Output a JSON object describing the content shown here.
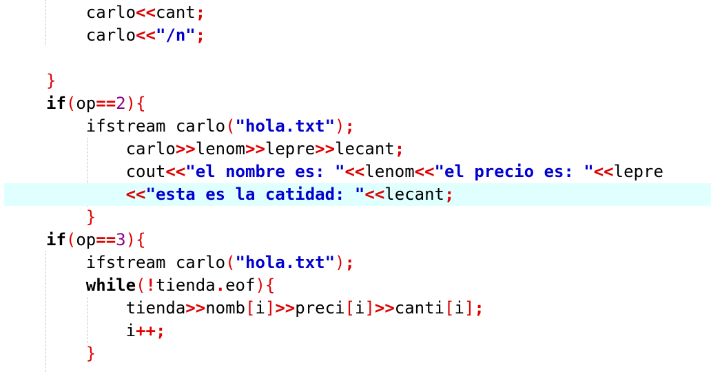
{
  "editor": {
    "current_line_color": "#e0ffff",
    "colors": {
      "operator": "#e00000",
      "number": "#8b008b",
      "string": "#0000d0",
      "keyword": "#000000",
      "plain": "#000000"
    },
    "lines": [
      {
        "tokens": [
          [
            "plain",
            "    carlo"
          ],
          [
            "op",
            "<<"
          ],
          [
            "plain",
            "cant"
          ],
          [
            "op",
            ";"
          ]
        ]
      },
      {
        "tokens": [
          [
            "plain",
            "    carlo"
          ],
          [
            "op",
            "<<"
          ],
          [
            "str",
            "\"/n\""
          ],
          [
            "op",
            ";"
          ]
        ]
      },
      {
        "tokens": []
      },
      {
        "tokens": [
          [
            "brk",
            "}"
          ]
        ]
      },
      {
        "tokens": [
          [
            "kw",
            "if"
          ],
          [
            "brk",
            "("
          ],
          [
            "plain",
            "op"
          ],
          [
            "op",
            "=="
          ],
          [
            "num",
            "2"
          ],
          [
            "brk",
            ")"
          ],
          [
            "brk",
            "{"
          ]
        ]
      },
      {
        "tokens": [
          [
            "plain",
            "    ifstream carlo"
          ],
          [
            "brk",
            "("
          ],
          [
            "str",
            "\"hola.txt\""
          ],
          [
            "brk",
            ")"
          ],
          [
            "op",
            ";"
          ]
        ]
      },
      {
        "tokens": [
          [
            "plain",
            "        carlo"
          ],
          [
            "op",
            ">>"
          ],
          [
            "plain",
            "lenom"
          ],
          [
            "op",
            ">>"
          ],
          [
            "plain",
            "lepre"
          ],
          [
            "op",
            ">>"
          ],
          [
            "plain",
            "lecant"
          ],
          [
            "op",
            ";"
          ]
        ]
      },
      {
        "tokens": [
          [
            "plain",
            "        cout"
          ],
          [
            "op",
            "<<"
          ],
          [
            "str",
            "\"el nombre es: \""
          ],
          [
            "op",
            "<<"
          ],
          [
            "plain",
            "lenom"
          ],
          [
            "op",
            "<<"
          ],
          [
            "str",
            "\"el precio es: \""
          ],
          [
            "op",
            "<<"
          ],
          [
            "plain",
            "lepre"
          ]
        ]
      },
      {
        "tokens": [
          [
            "plain",
            "        "
          ],
          [
            "op",
            "<<"
          ],
          [
            "str",
            "\"esta es la catidad: \""
          ],
          [
            "op",
            "<<"
          ],
          [
            "plain",
            "lecant"
          ],
          [
            "op",
            ";"
          ]
        ],
        "current": true
      },
      {
        "tokens": [
          [
            "plain",
            "    "
          ],
          [
            "brk",
            "}"
          ]
        ]
      },
      {
        "tokens": [
          [
            "kw",
            "if"
          ],
          [
            "brk",
            "("
          ],
          [
            "plain",
            "op"
          ],
          [
            "op",
            "=="
          ],
          [
            "num",
            "3"
          ],
          [
            "brk",
            ")"
          ],
          [
            "brk",
            "{"
          ]
        ]
      },
      {
        "tokens": [
          [
            "plain",
            "    ifstream carlo"
          ],
          [
            "brk",
            "("
          ],
          [
            "str",
            "\"hola.txt\""
          ],
          [
            "brk",
            ")"
          ],
          [
            "op",
            ";"
          ]
        ]
      },
      {
        "tokens": [
          [
            "plain",
            "    "
          ],
          [
            "kw",
            "while"
          ],
          [
            "brk",
            "("
          ],
          [
            "op",
            "!"
          ],
          [
            "plain",
            "tienda"
          ],
          [
            "op",
            "."
          ],
          [
            "plain",
            "eof"
          ],
          [
            "brk",
            ")"
          ],
          [
            "brk",
            "{"
          ]
        ]
      },
      {
        "tokens": [
          [
            "plain",
            "        tienda"
          ],
          [
            "op",
            ">>"
          ],
          [
            "plain",
            "nomb"
          ],
          [
            "brk",
            "["
          ],
          [
            "plain",
            "i"
          ],
          [
            "brk",
            "]"
          ],
          [
            "op",
            ">>"
          ],
          [
            "plain",
            "preci"
          ],
          [
            "brk",
            "["
          ],
          [
            "plain",
            "i"
          ],
          [
            "brk",
            "]"
          ],
          [
            "op",
            ">>"
          ],
          [
            "plain",
            "canti"
          ],
          [
            "brk",
            "["
          ],
          [
            "plain",
            "i"
          ],
          [
            "brk",
            "]"
          ],
          [
            "op",
            ";"
          ]
        ]
      },
      {
        "tokens": [
          [
            "plain",
            "        i"
          ],
          [
            "op",
            "++"
          ],
          [
            "op",
            ";"
          ]
        ]
      },
      {
        "tokens": [
          [
            "plain",
            "    "
          ],
          [
            "brk",
            "}"
          ]
        ]
      }
    ]
  }
}
